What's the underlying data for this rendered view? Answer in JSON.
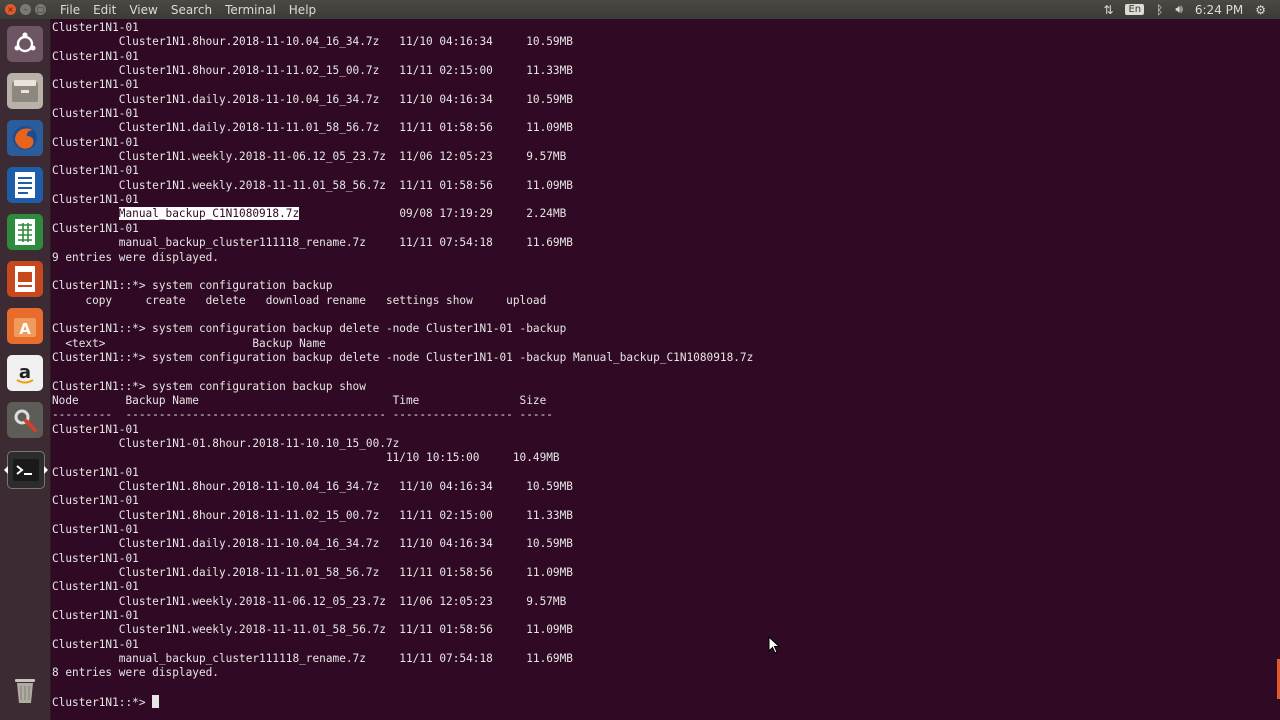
{
  "menubar": {
    "menus": [
      "File",
      "Edit",
      "View",
      "Search",
      "Terminal",
      "Help"
    ],
    "indicators": {
      "keyboard": "En",
      "time": "6:24 PM"
    }
  },
  "launcher": {
    "items": [
      "ubuntu-dash",
      "files",
      "firefox",
      "libreoffice-writer",
      "libreoffice-calc",
      "libreoffice-impress",
      "ubuntu-software",
      "amazon",
      "system-settings",
      "terminal",
      "trash"
    ]
  },
  "terminal": {
    "lines_before": [
      "Cluster1N1-01",
      "          Cluster1N1.8hour.2018-11-10.04_16_34.7z   11/10 04:16:34     10.59MB",
      "Cluster1N1-01",
      "          Cluster1N1.8hour.2018-11-11.02_15_00.7z   11/11 02:15:00     11.33MB",
      "Cluster1N1-01",
      "          Cluster1N1.daily.2018-11-10.04_16_34.7z   11/10 04:16:34     10.59MB",
      "Cluster1N1-01",
      "          Cluster1N1.daily.2018-11-11.01_58_56.7z   11/11 01:58:56     11.09MB",
      "Cluster1N1-01",
      "          Cluster1N1.weekly.2018-11-06.12_05_23.7z  11/06 12:05:23     9.57MB",
      "Cluster1N1-01",
      "          Cluster1N1.weekly.2018-11-11.01_58_56.7z  11/11 01:58:56     11.09MB",
      "Cluster1N1-01"
    ],
    "highlight_prefix": "          ",
    "highlight_text": "Manual_backup_C1N1080918.7z",
    "highlight_suffix": "               09/08 17:19:29     2.24MB",
    "lines_after": [
      "Cluster1N1-01",
      "          manual_backup_cluster111118_rename.7z     11/11 07:54:18     11.69MB",
      "9 entries were displayed.",
      "",
      "Cluster1N1::*> system configuration backup",
      "     copy     create   delete   download rename   settings show     upload",
      "",
      "Cluster1N1::*> system configuration backup delete -node Cluster1N1-01 -backup",
      "  <text>                      Backup Name",
      "Cluster1N1::*> system configuration backup delete -node Cluster1N1-01 -backup Manual_backup_C1N1080918.7z",
      "",
      "Cluster1N1::*> system configuration backup show",
      "Node       Backup Name                             Time               Size",
      "---------  --------------------------------------- ------------------ -----",
      "Cluster1N1-01",
      "          Cluster1N1-01.8hour.2018-11-10.10_15_00.7z",
      "                                                  11/10 10:15:00     10.49MB",
      "Cluster1N1-01",
      "          Cluster1N1.8hour.2018-11-10.04_16_34.7z   11/10 04:16:34     10.59MB",
      "Cluster1N1-01",
      "          Cluster1N1.8hour.2018-11-11.02_15_00.7z   11/11 02:15:00     11.33MB",
      "Cluster1N1-01",
      "          Cluster1N1.daily.2018-11-10.04_16_34.7z   11/10 04:16:34     10.59MB",
      "Cluster1N1-01",
      "          Cluster1N1.daily.2018-11-11.01_58_56.7z   11/11 01:58:56     11.09MB",
      "Cluster1N1-01",
      "          Cluster1N1.weekly.2018-11-06.12_05_23.7z  11/06 12:05:23     9.57MB",
      "Cluster1N1-01",
      "          Cluster1N1.weekly.2018-11-11.01_58_56.7z  11/11 01:58:56     11.09MB",
      "Cluster1N1-01",
      "          manual_backup_cluster111118_rename.7z     11/11 07:54:18     11.69MB",
      "8 entries were displayed.",
      ""
    ],
    "prompt": "Cluster1N1::*> "
  }
}
